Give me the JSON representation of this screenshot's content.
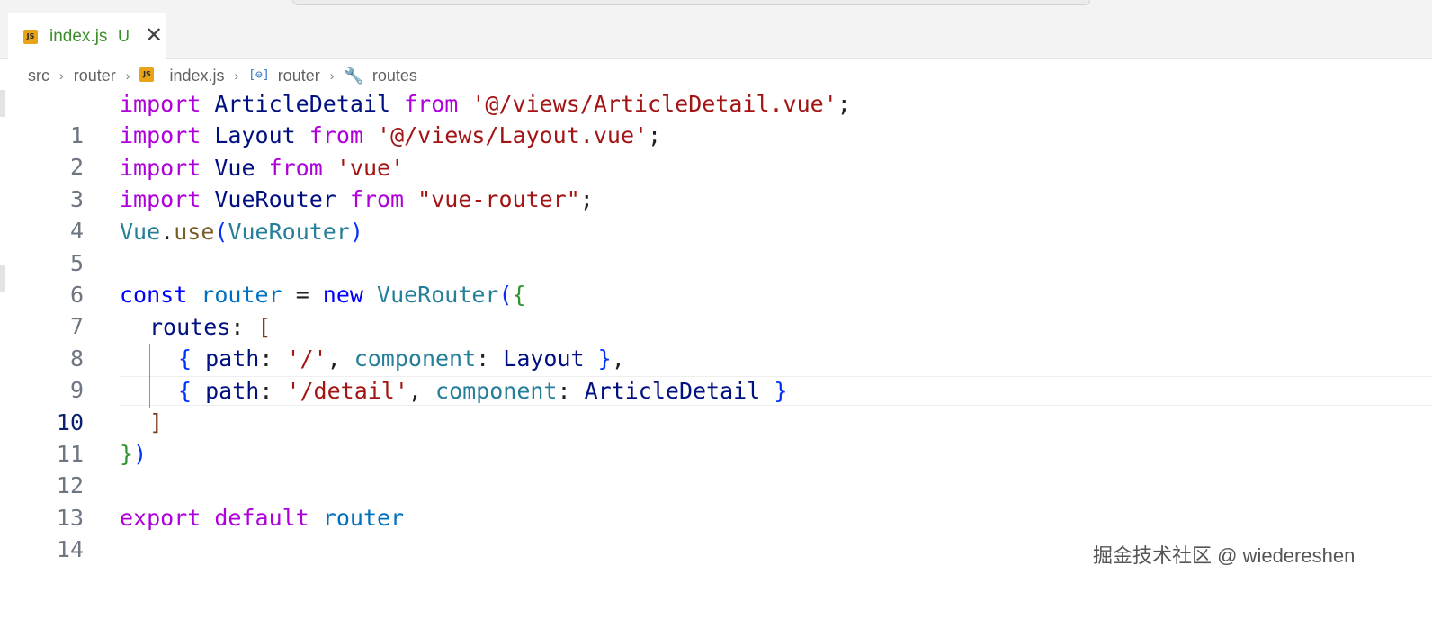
{
  "tab": {
    "icon": "js-file-icon",
    "js_icon_text": "JS",
    "filename": "index.js",
    "status": "U",
    "close_glyph": "✕"
  },
  "breadcrumb": {
    "items": [
      "src",
      "router",
      "index.js",
      "router",
      "routes"
    ],
    "separator": "›",
    "js_icon_text": "JS",
    "symbol_glyph": "[⊖]",
    "wrench_glyph": "🔧"
  },
  "editor": {
    "active_line": 10,
    "line_numbers": [
      "1",
      "2",
      "3",
      "4",
      "5",
      "6",
      "7",
      "8",
      "9",
      "10",
      "11",
      "12",
      "13",
      "14"
    ],
    "tokens": {
      "l1": [
        "import",
        " ArticleDetail ",
        "from",
        " ",
        "'@/views/ArticleDetail.vue'",
        ";"
      ],
      "l2": [
        "import",
        " Layout ",
        "from",
        " ",
        "'@/views/Layout.vue'",
        ";"
      ],
      "l3": [
        "import",
        " Vue ",
        "from",
        " ",
        "'vue'"
      ],
      "l4": [
        "import",
        " VueRouter ",
        "from",
        " ",
        "\"vue-router\"",
        ";"
      ],
      "l5": [
        "Vue",
        ".",
        "use",
        "(",
        "VueRouter",
        ")"
      ],
      "l7": [
        "const",
        " ",
        "router",
        " = ",
        "new",
        " ",
        "VueRouter",
        "(",
        "{"
      ],
      "l8": [
        "routes",
        ": ",
        "["
      ],
      "l9": [
        "{",
        " path",
        ": ",
        "'/'",
        ", ",
        "component",
        ": ",
        "Layout",
        " ",
        "}",
        ","
      ],
      "l10": [
        "{",
        " path",
        ": ",
        "'/detail'",
        ", ",
        "component",
        ": ",
        "ArticleDetail",
        " ",
        "}"
      ],
      "l11": [
        "]"
      ],
      "l12": [
        "}",
        ")"
      ],
      "l14": [
        "export",
        " ",
        "default",
        " ",
        "router"
      ]
    }
  },
  "watermark": "掘金技术社区 @ wiedereshen"
}
